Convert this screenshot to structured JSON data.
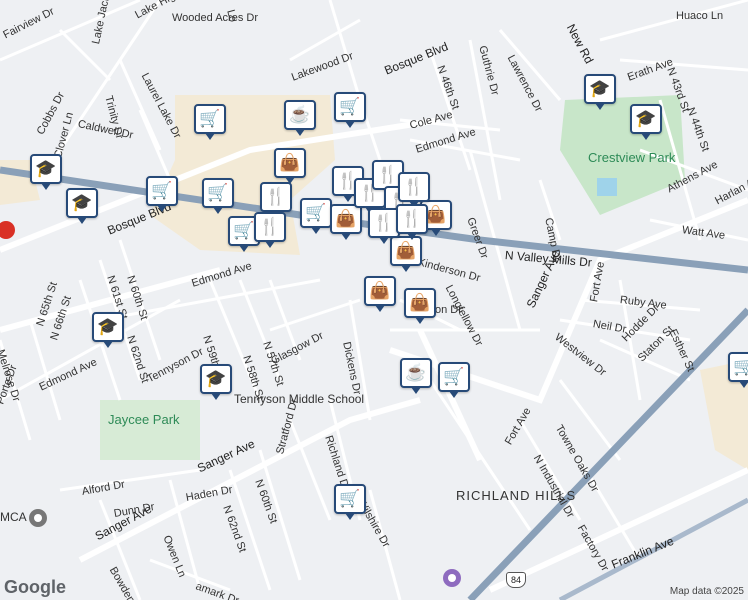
{
  "map": {
    "streets": [
      "Cobbs Dr",
      "Fairview Dr",
      "Lake Jackson",
      "Lake Highlands",
      "Wooded Acres Dr",
      "Laurel Lake Dr",
      "Trinity Dr",
      "Caldwell Dr",
      "Lakewood Dr",
      "Bosque Blvd",
      "N 46th St",
      "Guthrie Dr",
      "Lawrence Dr",
      "New Rd",
      "Huaco Ln",
      "Huaco Ln",
      "Erath Ave",
      "N 43rd St",
      "N 44th St",
      "Cole Ave",
      "Edmond Ave",
      "Sth Ave",
      "Clover Ln",
      "Bosque Blvd",
      "N 60th St",
      "N 61st St",
      "N 62nd St",
      "Edmond Ave",
      "N 59th St",
      "N 57th St",
      "N 58th St",
      "Glasgow Dr",
      "Dickens Dr",
      "Kinderson Dr",
      "on Dr",
      "Longfellow Dr",
      "Greer Dr",
      "Camp Dr",
      "N Valley Mills Dr",
      "Athens Ave",
      "Harlan Av",
      "Watt Ave",
      "Ruby Ave",
      "Fort Ave",
      "Esther St",
      "Neil Dr",
      "Hodde Dr",
      "Staton St",
      "Westview Dr",
      "Sanger Ave",
      "Melrose Dr",
      "N 65th St",
      "N 66th St",
      "Edmond Ave",
      "Tennyson Dr",
      "Richland Dr",
      "Stratford Dr",
      "Sanger Ave",
      "N 60th St",
      "N 62nd St",
      "Alford Dr",
      "Dunn Dr",
      "Haden Dr",
      "Owen Ln",
      "Bowden St",
      "Wilshire Dr",
      "Towne Oaks Dr",
      "N Industrial Dr",
      "Fort Ave",
      "Factory Dr",
      "Franklin Ave",
      "amark Dr",
      "Porte Dr",
      "ger Dr",
      "Lo"
    ],
    "places": {
      "crestview_park": "Crestview Park",
      "jaycee_park": "Jaycee Park",
      "tennyson_school": "Tennyson Middle School",
      "richland_hills": "RICHLAND HILLS",
      "ymca": "MCA"
    },
    "highway_shield": "84",
    "google_logo": "Google",
    "attribution": "Map data ©2025"
  },
  "pins": [
    {
      "type": "school-icon",
      "glyph": "🎓"
    },
    {
      "type": "school-icon",
      "glyph": "🎓"
    },
    {
      "type": "school-icon",
      "glyph": "🎓"
    },
    {
      "type": "school-icon",
      "glyph": "🎓"
    },
    {
      "type": "school-icon",
      "glyph": "🎓"
    },
    {
      "type": "cart-icon",
      "glyph": "🛒"
    },
    {
      "type": "cart-icon",
      "glyph": "🛒"
    },
    {
      "type": "cart-icon",
      "glyph": "🛒"
    },
    {
      "type": "cart-icon",
      "glyph": "🛒"
    },
    {
      "type": "cart-icon",
      "glyph": "🛒"
    },
    {
      "type": "cart-icon",
      "glyph": "🛒"
    },
    {
      "type": "cart-icon",
      "glyph": "🛒"
    },
    {
      "type": "cart-icon",
      "glyph": "🛒"
    },
    {
      "type": "cafe-icon",
      "glyph": "☕"
    },
    {
      "type": "cafe-icon",
      "glyph": "☕"
    },
    {
      "type": "bag-icon",
      "glyph": "👜"
    },
    {
      "type": "bag-icon",
      "glyph": "👜"
    },
    {
      "type": "bag-icon",
      "glyph": "👜"
    },
    {
      "type": "bag-icon",
      "glyph": "👜"
    },
    {
      "type": "bag-icon",
      "glyph": "👜"
    },
    {
      "type": "bag-icon",
      "glyph": "👜"
    },
    {
      "type": "restaurant-icon",
      "glyph": "🍴"
    },
    {
      "type": "restaurant-icon",
      "glyph": "🍴"
    },
    {
      "type": "restaurant-icon",
      "glyph": "🍴"
    },
    {
      "type": "restaurant-icon",
      "glyph": "🍴"
    },
    {
      "type": "restaurant-icon",
      "glyph": "🍴"
    },
    {
      "type": "restaurant-icon",
      "glyph": "🍴"
    },
    {
      "type": "restaurant-icon",
      "glyph": "🍴"
    },
    {
      "type": "restaurant-icon",
      "glyph": "🍴"
    },
    {
      "type": "restaurant-icon",
      "glyph": "🍴"
    },
    {
      "type": "school-icon",
      "glyph": "🎓"
    }
  ],
  "colors": {
    "pin_border": "#274a78",
    "park": "#c8e6c9",
    "commercial": "#f3ead6",
    "highway": "#8aa0b8",
    "water": "#9fd3ea"
  }
}
